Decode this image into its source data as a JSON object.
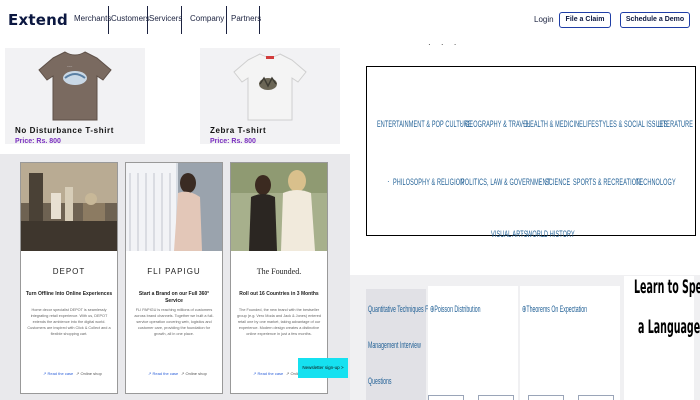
{
  "header": {
    "logo": "Extend",
    "nav": [
      "Merchants",
      "Customers",
      "Servicers",
      "Company",
      "Partners"
    ],
    "login": "Login",
    "file_claim": "File a Claim",
    "schedule_demo": "Schedule a Demo"
  },
  "products": [
    {
      "title": "No Disturbance T-shirt",
      "price": "Price: Rs. 800",
      "shirt_color": "#7a6a60"
    },
    {
      "title": "Zebra T-shirt",
      "price": "Price: Rs. 800",
      "shirt_color": "#f4f4f4"
    }
  ],
  "brands": [
    {
      "name": "DEPOT",
      "headline": "Turn Offline Into Online Experiences",
      "body": "Home decor specialist DEPOT is seamlessly integrating retail experience. With us, DEPOT extends the ambience into the digital world. Customers are inspired with Click & Collect and a flexible shopping cart.",
      "read": "Read the case",
      "shop": "Online shop"
    },
    {
      "name": "FLI PAPIGU",
      "headline": "Start a Brand on our Full 360° Service",
      "body": "FLI PAPIGU is reaching millions of customers across brand channels. Together we built a full-service operation covering web, logistics and customer care, providing the foundation for growth, all in one place.",
      "read": "Read the case",
      "shop": "Online shop"
    },
    {
      "name": "The Founded.",
      "headline": "Roll out 16 Countries in 3 Months",
      "body": "The Founded, the new brand with the bestseller group (e.g. Vero Moda and Jack & Jones) entered retail one by one market, taking advantage of our experience. Modern design creates a distinctive online experience in just a few months.",
      "read": "Read the case",
      "shop": "Online shop"
    }
  ],
  "newsletter": "Newsletter sign-up >",
  "categories": [
    "ENTERTAINMENT & POP CULTURE",
    "GEOGRAPHY & TRAVEL",
    "HEALTH & MEDICINE",
    "LIFESTYLES & SOCIAL ISSUES",
    "LITERATURE",
    "PHILOSOPHY & RELIGION",
    "POLITICS, LAW & GOVERNMENT",
    "SCIENCE",
    "SPORTS & RECREATION",
    "TECHNOLOGY",
    "VISUAL ARTS",
    "WORLD HISTORY"
  ],
  "topics": {
    "left": [
      "Quantitative Techniques For",
      "Management Interview",
      "Questions"
    ],
    "mid1": "Poisson Distribution",
    "mid2": "Theorems On Expectation",
    "book": [
      "Learn to Speak",
      "a Language"
    ]
  },
  "colors": {
    "accent_blue": "#1f3ea6",
    "category_blue": "#1f5f95",
    "price_purple": "#7a2fbf",
    "newsletter_cyan": "#15e1f0"
  }
}
